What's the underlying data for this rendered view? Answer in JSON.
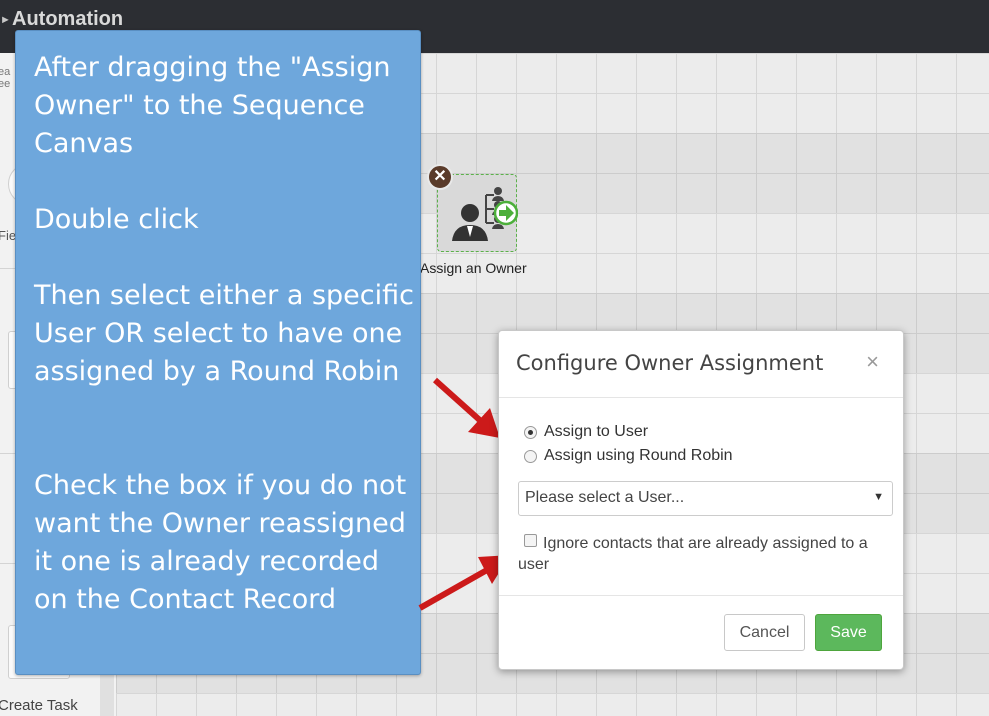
{
  "header": {
    "title": "Automation"
  },
  "left_panel": {
    "peek_text": "ea\nee",
    "field_peek": "Fie",
    "create_task": "Create Task"
  },
  "canvas": {
    "node": {
      "label": "Assign an Owner",
      "icon": "assign-owner-icon"
    }
  },
  "callout": {
    "paragraphs": [
      "After dragging the \"Assign Owner\" to the Sequence Canvas",
      "Double click",
      "Then select either a specific User OR select to have one assigned by a Round Robin",
      "Check the box if you do not want the Owner reassigned it one is already recorded on the Contact Record"
    ]
  },
  "modal": {
    "title": "Configure Owner Assignment",
    "close": "×",
    "radio_user": "Assign to User",
    "radio_robin": "Assign using Round Robin",
    "select_placeholder": "Please select a User...",
    "select_arrow": "▼",
    "checkbox_label": "Ignore contacts that are already assigned to a user",
    "cancel": "Cancel",
    "save": "Save"
  },
  "colors": {
    "callout_bg": "#6ea7dc",
    "save_bg": "#5cb85c",
    "arrow": "#cc1a1a",
    "topbar": "#2c2e33"
  }
}
